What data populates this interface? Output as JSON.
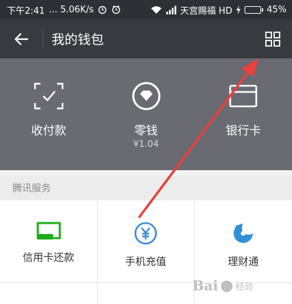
{
  "status_bar": {
    "time": "下午2:41",
    "net_speed": "... 5.06K/s",
    "carrier": "天宫赐福 HD",
    "battery_level": 0.45,
    "battery_text": "45%",
    "icons": [
      "alarm-icon",
      "clock-icon",
      "wifi-icon",
      "signal-icon",
      "charging-icon"
    ]
  },
  "nav": {
    "title": "我的钱包",
    "back_icon": "arrow-left-icon",
    "menu_icon": "grid-icon"
  },
  "top_items": [
    {
      "label": "收付款",
      "icon": "scan-check-icon"
    },
    {
      "label": "零钱",
      "sub": "¥1.04",
      "icon": "coin-diamond-icon"
    },
    {
      "label": "银行卡",
      "icon": "card-icon"
    }
  ],
  "section": {
    "title": "腾讯服务"
  },
  "services": [
    {
      "label": "信用卡还款",
      "icon": "credit-card-repay-icon",
      "color": "#1aad19"
    },
    {
      "label": "手机充值",
      "icon": "yen-circle-icon",
      "color": "#3f8ed8"
    },
    {
      "label": "理财通",
      "icon": "licaitong-icon",
      "color": "#2f8fd8"
    }
  ],
  "annotation": {
    "color": "#e8403a"
  },
  "watermark": {
    "brand": "Bai",
    "text": "经验"
  }
}
